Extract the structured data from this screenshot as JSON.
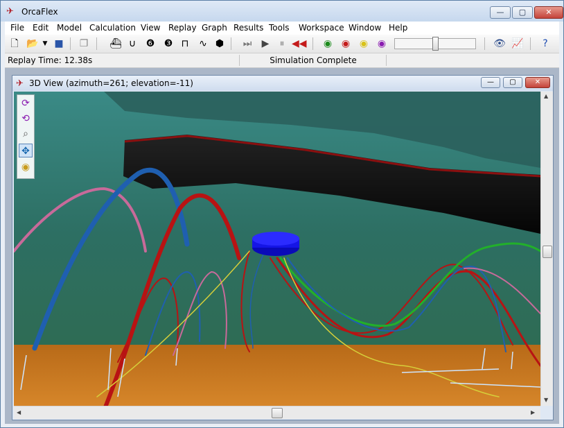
{
  "window": {
    "title": "OrcaFlex",
    "min": "—",
    "max": "▢",
    "close": "✕"
  },
  "menu": [
    "File",
    "Edit",
    "Model",
    "Calculation",
    "View",
    "Replay",
    "Graph",
    "Results",
    "Tools",
    "Workspace",
    "Window",
    "Help"
  ],
  "status": {
    "replay_time": "Replay Time: 12.38s",
    "state": "Simulation Complete"
  },
  "child": {
    "title": "3D View (azimuth=261; elevation=-11)"
  },
  "toolbar_icons": [
    "new-icon",
    "open-icon",
    "dropdown-icon",
    "save-icon",
    "copy-icon",
    "vessel-icon",
    "winch-icon",
    "buoy6-icon",
    "buoy3-icon",
    "link-icon",
    "line-icon",
    "shapes-icon",
    "step-icon",
    "play-icon",
    "pause-icon",
    "rewind-icon",
    "start-statics-icon",
    "run-icon",
    "calculate-icon",
    "reset-icon",
    "view-icon",
    "graph-icon",
    "help-icon"
  ],
  "colors": {
    "sea_top": "#2f7a76",
    "sea_mid": "#2f6e5e",
    "seabed": "#c9781f",
    "hull": "#111111",
    "blue_line": "#1f5fb0",
    "red_line": "#b81313",
    "pink_line": "#c86a9a",
    "green_line": "#22b02a",
    "yellow_line": "#d6cf3a",
    "buoy": "#1515e6"
  }
}
